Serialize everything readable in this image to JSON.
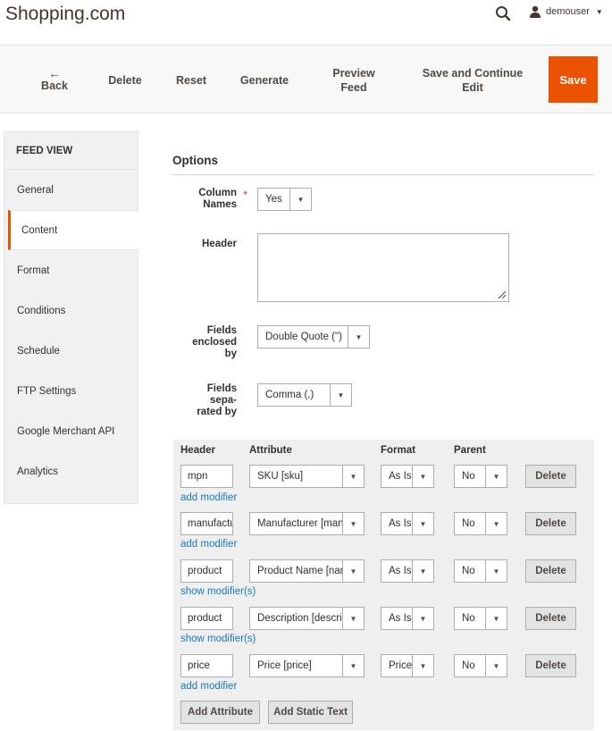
{
  "header": {
    "title": "Shopping.com",
    "username": "demouser"
  },
  "actions": {
    "back": "Back",
    "delete": "Delete",
    "reset": "Reset",
    "generate": "Generate",
    "preview_line1": "Preview",
    "preview_line2": "Feed",
    "save_continue_line1": "Save and Continue",
    "save_continue_line2": "Edit",
    "save": "Save"
  },
  "sidebar": {
    "title": "FEED VIEW",
    "items": [
      "General",
      "Content",
      "Format",
      "Conditions",
      "Schedule",
      "FTP Settings",
      "Google Merchant API",
      "Analytics"
    ],
    "active": "Content"
  },
  "options": {
    "title": "Options",
    "column_names": {
      "label_line1": "Column",
      "label_line2": "Names",
      "required_mark": "*",
      "value": "Yes"
    },
    "header": {
      "label": "Header",
      "value": ""
    },
    "fields_enclosed": {
      "label_line1": "Fields",
      "label_line2": "enclosed",
      "label_line3": "by",
      "value": "Double Quote (\")"
    },
    "fields_separated": {
      "label_line1": "Fields",
      "label_line2": "sepa-",
      "label_line3": "rated by",
      "value": "Comma (,)"
    }
  },
  "grid": {
    "columns": {
      "header": "Header",
      "attribute": "Attribute",
      "format": "Format",
      "parent": "Parent"
    },
    "rows": [
      {
        "header": "mpn",
        "attribute": "SKU [sku]",
        "format": "As Is",
        "parent": "No",
        "delete": "Delete",
        "modifier": "add modifier"
      },
      {
        "header": "manufacturer",
        "attribute": "Manufacturer [manufacturer]",
        "format": "As Is",
        "parent": "No",
        "delete": "Delete",
        "modifier": "add modifier"
      },
      {
        "header": "product",
        "attribute": "Product Name [name]",
        "format": "As Is",
        "parent": "No",
        "delete": "Delete",
        "modifier": "show modifier(s)"
      },
      {
        "header": "product",
        "attribute": "Description [description]",
        "format": "As Is",
        "parent": "No",
        "delete": "Delete",
        "modifier": "show modifier(s)"
      },
      {
        "header": "price",
        "attribute": "Price [price]",
        "format": "Price",
        "parent": "No",
        "delete": "Delete",
        "modifier": "add modifier"
      }
    ],
    "add_attribute": "Add Attribute",
    "add_static_text": "Add Static Text"
  }
}
